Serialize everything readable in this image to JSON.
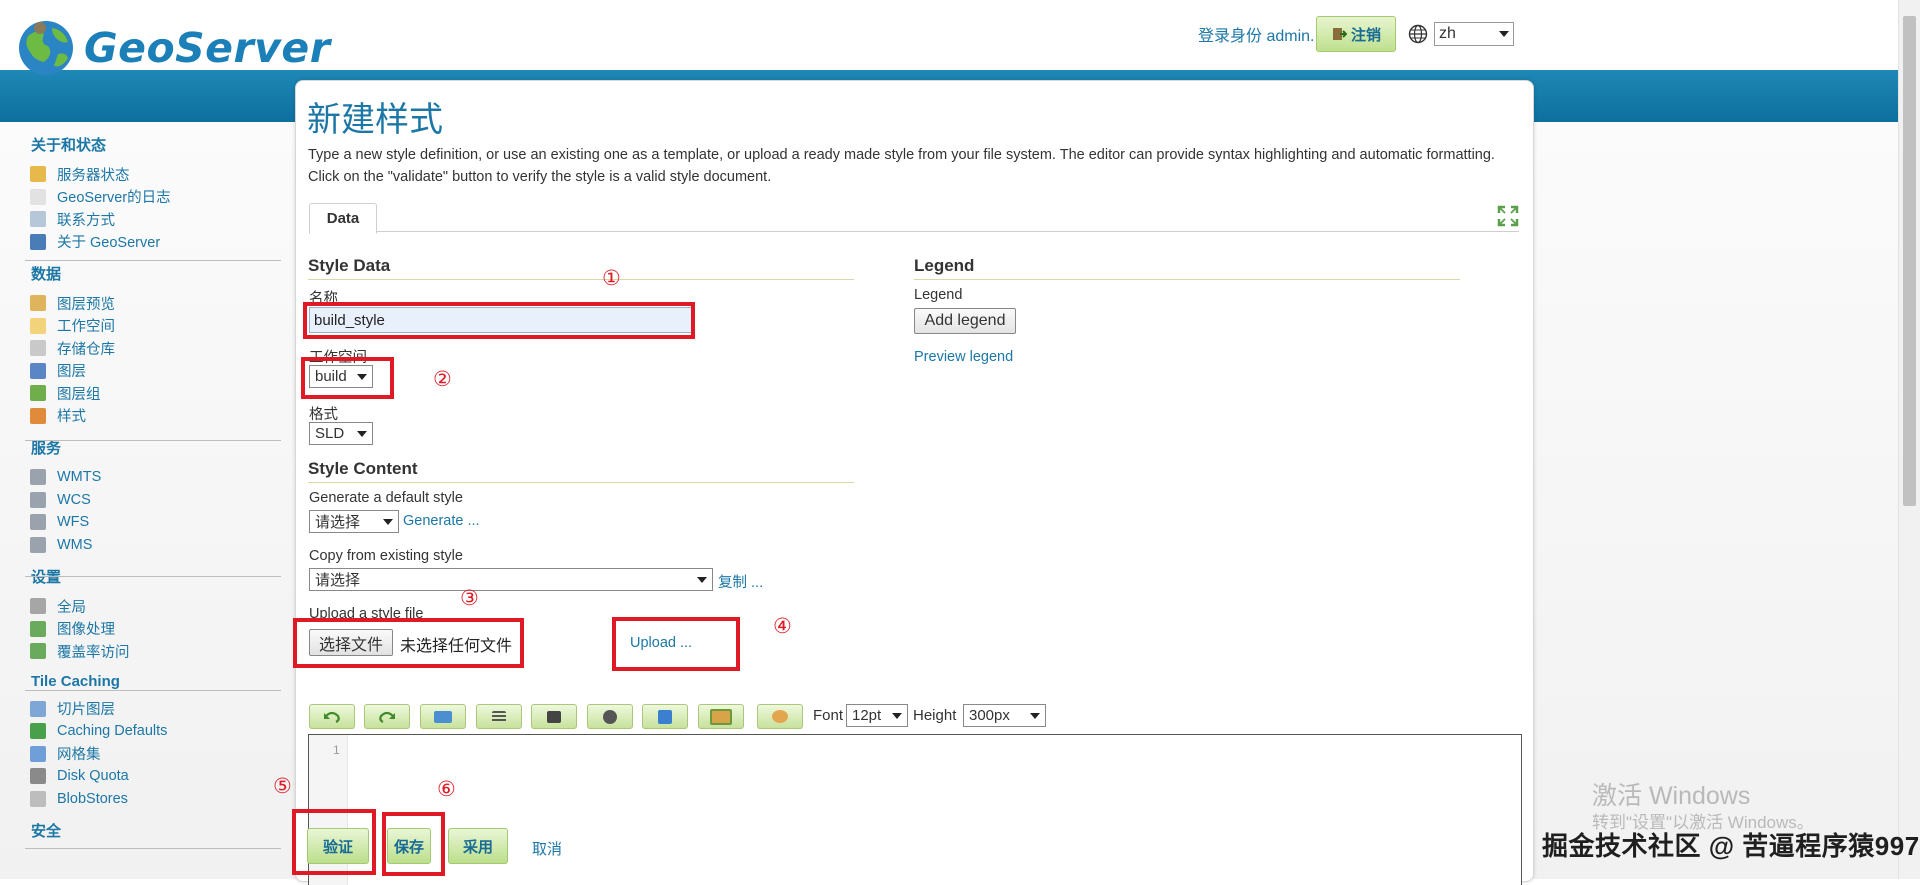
{
  "header": {
    "logo_text": "GeoServer",
    "login_text": "登录身份 admin.",
    "logout_label": "注销",
    "language": "zh"
  },
  "sidebar": {
    "sections": [
      {
        "title": "关于和状态",
        "items": [
          {
            "label": "服务器状态",
            "icon": "server-status-icon",
            "color": "#e7b94a"
          },
          {
            "label": "GeoServer的日志",
            "icon": "log-icon",
            "color": "#e2e2e2"
          },
          {
            "label": "联系方式",
            "icon": "contact-icon",
            "color": "#b6c7d9"
          },
          {
            "label": "关于 GeoServer",
            "icon": "about-icon",
            "color": "#4a7db8"
          }
        ]
      },
      {
        "title": "数据",
        "items": [
          {
            "label": "图层预览",
            "icon": "layer-preview-icon",
            "color": "#e0b35d"
          },
          {
            "label": "工作空间",
            "icon": "workspace-icon",
            "color": "#f2d27a"
          },
          {
            "label": "存储仓库",
            "icon": "store-icon",
            "color": "#c9c9c9"
          },
          {
            "label": "图层",
            "icon": "layers-icon",
            "color": "#5b86c6"
          },
          {
            "label": "图层组",
            "icon": "layer-group-icon",
            "color": "#6fae4a"
          },
          {
            "label": "样式",
            "icon": "styles-icon",
            "color": "#e08b3c"
          }
        ]
      },
      {
        "title": "服务",
        "items": [
          {
            "label": "WMTS",
            "icon": "wmts-icon",
            "color": "#9aa3ad"
          },
          {
            "label": "WCS",
            "icon": "wcs-icon",
            "color": "#9aa3ad"
          },
          {
            "label": "WFS",
            "icon": "wfs-icon",
            "color": "#9aa3ad"
          },
          {
            "label": "WMS",
            "icon": "wms-icon",
            "color": "#9aa3ad"
          }
        ]
      },
      {
        "title": "设置",
        "items": [
          {
            "label": "全局",
            "icon": "global-icon",
            "color": "#a6a6a6"
          },
          {
            "label": "图像处理",
            "icon": "image-processing-icon",
            "color": "#6aaa5c"
          },
          {
            "label": "覆盖率访问",
            "icon": "coverage-access-icon",
            "color": "#6aaa5c"
          }
        ]
      },
      {
        "title": "Tile Caching",
        "items": [
          {
            "label": "切片图层",
            "icon": "tile-layers-icon",
            "color": "#7ea6d6"
          },
          {
            "label": "Caching Defaults",
            "icon": "caching-defaults-icon",
            "color": "#49a04a"
          },
          {
            "label": "网格集",
            "icon": "gridsets-icon",
            "color": "#6f9fd8"
          },
          {
            "label": "Disk Quota",
            "icon": "disk-quota-icon",
            "color": "#8a8a8a"
          },
          {
            "label": "BlobStores",
            "icon": "blobstores-icon",
            "color": "#bdbdbd"
          }
        ]
      },
      {
        "title": "安全",
        "items": []
      }
    ]
  },
  "main": {
    "title": "新建样式",
    "description": "Type a new style definition, or use an existing one as a template, or upload a ready made style from your file system. The editor can provide syntax highlighting and automatic formatting. Click on the \"validate\" button to verify the style is a valid style document.",
    "tab_label": "Data",
    "style_data": {
      "heading": "Style Data",
      "name_label": "名称",
      "name_value": "build_style",
      "workspace_label": "工作空间",
      "workspace_value": "build",
      "format_label": "格式",
      "format_value": "SLD"
    },
    "legend": {
      "heading": "Legend",
      "label": "Legend",
      "add_button": "Add legend",
      "preview_link": "Preview legend"
    },
    "style_content": {
      "heading": "Style Content",
      "generate_label": "Generate a default style",
      "generate_select": "请选择",
      "generate_link": "Generate ...",
      "copy_label": "Copy from existing style",
      "copy_select": "请选择",
      "copy_link": "复制 ...",
      "upload_label": "Upload a style file",
      "choose_file": "选择文件",
      "no_file": "未选择任何文件",
      "upload_link": "Upload ..."
    },
    "editor": {
      "font_label": "Font",
      "font_value": "12pt",
      "height_label": "Height",
      "height_value": "300px",
      "line_number": "1",
      "toolbar_icons": [
        "undo-icon",
        "redo-icon",
        "insert-image-icon",
        "format-icon",
        "color-picker-icon",
        "search-icon",
        "coverage-style-icon",
        "preview-icon",
        "palette-icon"
      ]
    },
    "actions": {
      "validate": "验证",
      "save": "保存",
      "apply": "采用",
      "cancel": "取消"
    }
  },
  "annotations": {
    "n1": "①",
    "n2": "②",
    "n3": "③",
    "n4": "④",
    "n5": "⑤",
    "n6": "⑥"
  },
  "watermark": {
    "line1": "激活 Windows",
    "line2": "转到\"设置\"以激活 Windows。",
    "site": "掘金技术社区 @ 苦逼程序猿997"
  },
  "colors": {
    "brand_blue": "#1c77a6",
    "header_bar": "#1f88b6",
    "button_green": "#c7e29b",
    "annotation_red": "#e01a24"
  }
}
